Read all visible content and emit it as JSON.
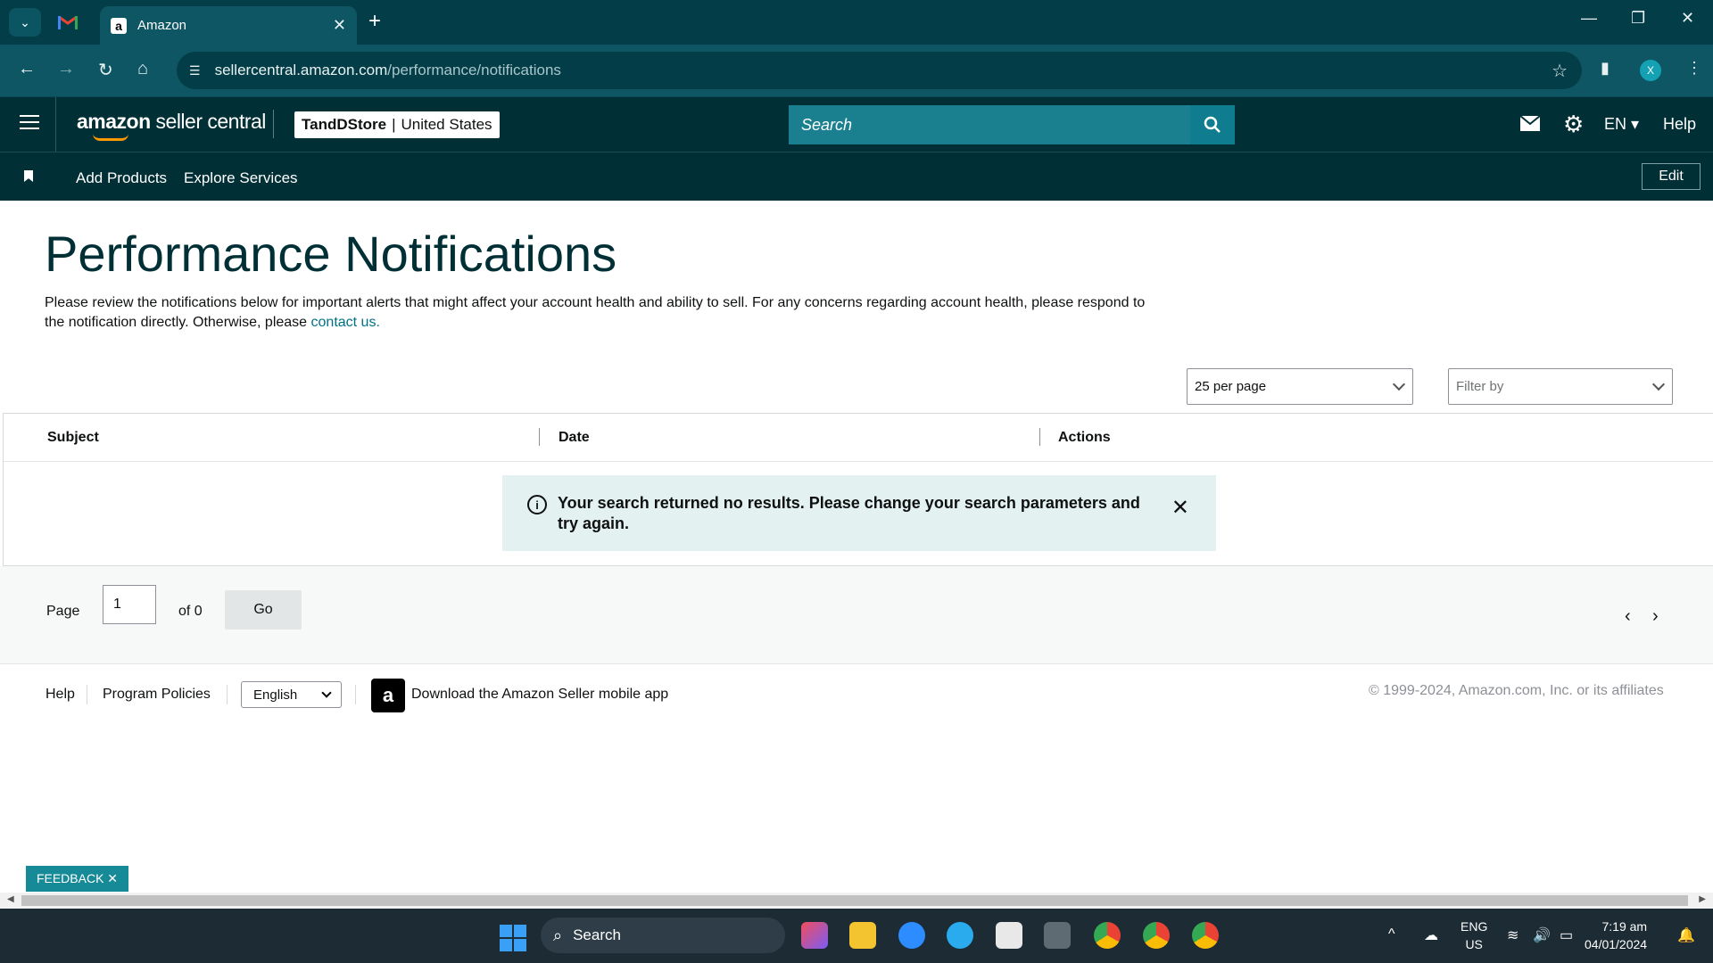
{
  "browser": {
    "tab_title": "Amazon",
    "url_domain": "sellercentral.amazon.com",
    "url_path": "/performance/notifications",
    "profile_initial": "X"
  },
  "header": {
    "logo_bold": "amazon",
    "logo_rest": " seller central",
    "store_name": "TandDStore",
    "store_region": "United States",
    "search_placeholder": "Search",
    "language": "EN",
    "help": "Help"
  },
  "subnav": {
    "items": [
      {
        "label": "Add Products"
      },
      {
        "label": "Explore Services"
      }
    ],
    "edit_label": "Edit"
  },
  "main": {
    "title": "Performance Notifications",
    "intro_text": "Please review the notifications below for important alerts that might affect your account health and ability to sell. For any concerns regarding account health, please respond to the notification directly. Otherwise, please ",
    "contact_link": "contact us.",
    "per_page": "25 per page",
    "filter_placeholder": "Filter by",
    "table": {
      "columns": [
        "Subject",
        "Date",
        "Actions"
      ]
    },
    "alert_message": "Your search returned no results. Please change your search parameters and try again.",
    "pager": {
      "page_label": "Page",
      "page_value": "1",
      "of_label": "of 0",
      "go_label": "Go"
    }
  },
  "footer": {
    "help": "Help",
    "policies": "Program Policies",
    "language": "English",
    "app_text": "Download the Amazon Seller mobile app",
    "copyright": "© 1999-2024, Amazon.com, Inc. or its affiliates"
  },
  "feedback_label": "FEEDBACK ✕",
  "taskbar": {
    "search_label": "Search",
    "lang_line1": "ENG",
    "lang_line2": "US",
    "time": "7:19 am",
    "date": "04/01/2024"
  },
  "colors": {
    "header_bg": "#002f36",
    "browser_bg": "#0e5664",
    "link": "#007185",
    "alert_bg": "#e3f1f1",
    "accent_orange": "#ff9900"
  }
}
